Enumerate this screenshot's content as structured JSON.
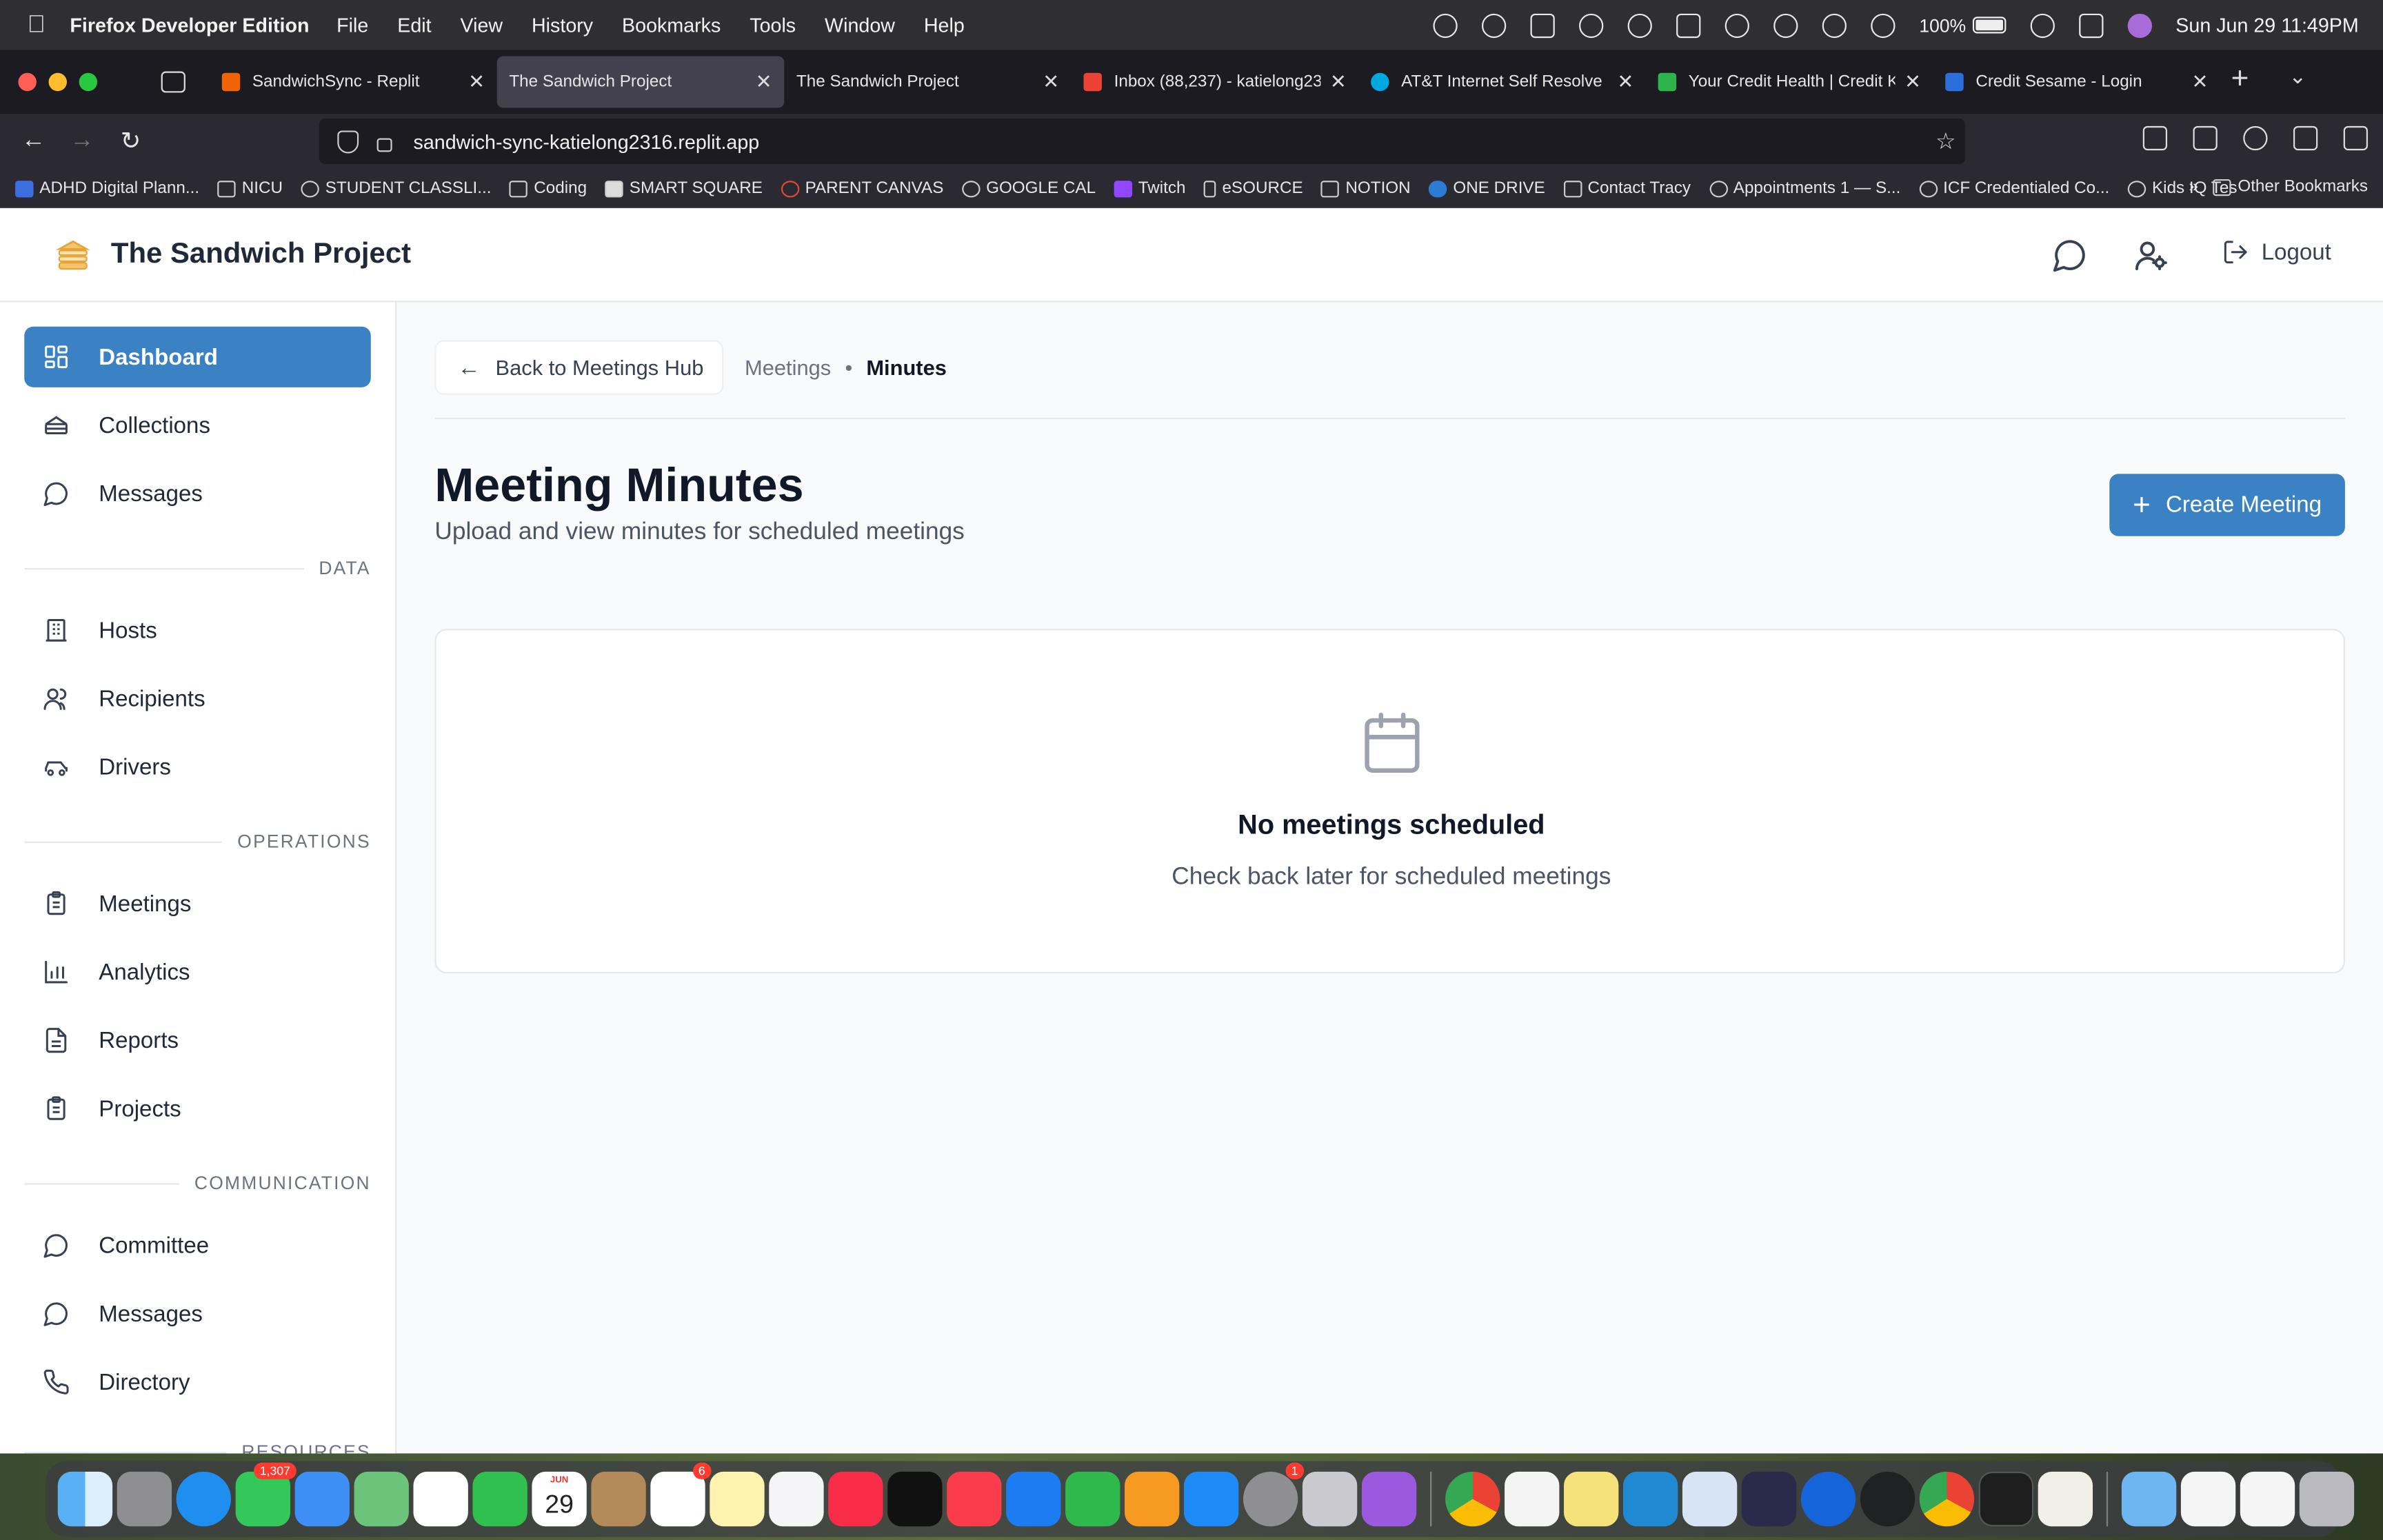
{
  "menubar": {
    "app_name": "Firefox Developer Edition",
    "menus": [
      "File",
      "Edit",
      "View",
      "History",
      "Bookmarks",
      "Tools",
      "Window",
      "Help"
    ],
    "battery": "100%",
    "datetime": "Sun Jun 29  11:49PM"
  },
  "browser": {
    "tabs": [
      {
        "title": "SandwichSync - Replit",
        "favicon_color": "#f26207",
        "active": false
      },
      {
        "title": "The Sandwich Project",
        "favicon_color": "",
        "active": true
      },
      {
        "title": "The Sandwich Project",
        "favicon_color": "",
        "active": false
      },
      {
        "title": "Inbox (88,237) - katielong23",
        "favicon_color": "#ea4335",
        "active": false
      },
      {
        "title": "AT&T Internet Self Resolve",
        "favicon_color": "#00a8e0",
        "active": false
      },
      {
        "title": "Your Credit Health | Credit Ka",
        "favicon_color": "#2fb44b",
        "active": false
      },
      {
        "title": "Credit Sesame - Login",
        "favicon_color": "#2c6fd8",
        "active": false
      }
    ],
    "url": "sandwich-sync-katielong2316.replit.app",
    "bookmarks": [
      "ADHD Digital Plann...",
      "NICU",
      "STUDENT CLASSLI...",
      "Coding",
      "SMART SQUARE",
      "PARENT CANVAS",
      "GOOGLE CAL",
      "Twitch",
      "eSOURCE",
      "NOTION",
      "ONE DRIVE",
      "Contact Tracy",
      "Appointments 1 — S...",
      "ICF Credentialed Co...",
      "Kids IQ Tes"
    ],
    "other_bookmarks": "Other Bookmarks"
  },
  "app": {
    "title": "The Sandwich Project",
    "logout_label": "Logout",
    "accent_color": "#3b82c4"
  },
  "sidebar": {
    "items_top": [
      {
        "label": "Dashboard",
        "icon": "dashboard-grid-icon",
        "active": true
      },
      {
        "label": "Collections",
        "icon": "collections-icon"
      },
      {
        "label": "Messages",
        "icon": "message-bubble-icon"
      }
    ],
    "section_data": "DATA",
    "items_data": [
      {
        "label": "Hosts",
        "icon": "building-icon"
      },
      {
        "label": "Recipients",
        "icon": "users-icon"
      },
      {
        "label": "Drivers",
        "icon": "car-icon"
      }
    ],
    "section_operations": "OPERATIONS",
    "items_operations": [
      {
        "label": "Meetings",
        "icon": "clipboard-icon"
      },
      {
        "label": "Analytics",
        "icon": "bar-chart-icon"
      },
      {
        "label": "Reports",
        "icon": "document-icon"
      },
      {
        "label": "Projects",
        "icon": "clipboard-icon"
      }
    ],
    "section_communication": "COMMUNICATION",
    "items_communication": [
      {
        "label": "Committee",
        "icon": "message-bubble-icon"
      },
      {
        "label": "Messages",
        "icon": "message-bubble-icon"
      },
      {
        "label": "Directory",
        "icon": "phone-icon"
      }
    ],
    "section_resources_partial": "RESOURCES"
  },
  "main": {
    "back_label": "Back to Meetings Hub",
    "breadcrumb": {
      "parent": "Meetings",
      "separator": "•",
      "current": "Minutes"
    },
    "title": "Meeting Minutes",
    "subtitle": "Upload and view minutes for scheduled meetings",
    "create_label": "Create Meeting",
    "empty": {
      "title": "No meetings scheduled",
      "subtitle": "Check back later for scheduled meetings"
    }
  },
  "dock": {
    "messages_badge": "1,307",
    "reminders_badge": "6",
    "calendar_month": "JUN",
    "calendar_day": "29",
    "settings_badge": "1"
  }
}
